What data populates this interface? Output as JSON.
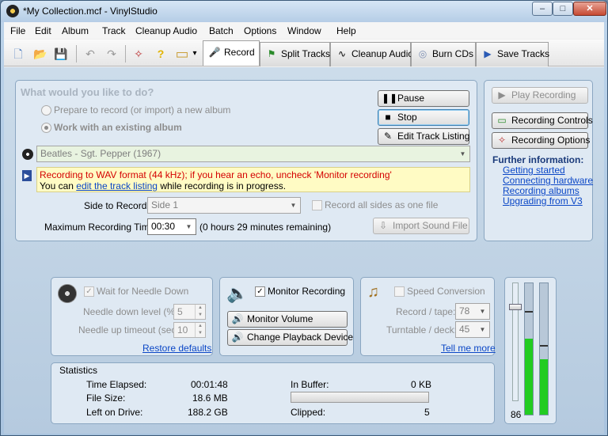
{
  "window": {
    "title": "*My Collection.mcf - VinylStudio",
    "min_glyph": "–",
    "max_glyph": "□",
    "close_glyph": "✕"
  },
  "menu": [
    "File",
    "Edit",
    "Album",
    "Track",
    "Cleanup Audio",
    "Batch",
    "Options",
    "Window",
    "Help"
  ],
  "toolbar": {
    "icons": {
      "new": "new-collection-icon",
      "open": "open-icon",
      "save": "save-icon",
      "undo": "undo-icon",
      "redo": "redo-icon",
      "tools": "wand-icon",
      "help": "help-icon",
      "folder": "folder-dropdown-icon"
    },
    "glyphs": {
      "new": "🗋",
      "open": "📂",
      "save": "💾",
      "undo": "↶",
      "redo": "↷",
      "tools": "✧",
      "help": "?",
      "folder": "▭",
      "dropdown": "▾"
    }
  },
  "tabs": [
    {
      "label": "Record",
      "icon": "🎤",
      "active": true
    },
    {
      "label": "Split Tracks",
      "icon": "⚑",
      "active": false
    },
    {
      "label": "Cleanup Audio",
      "icon": "∿",
      "active": false
    },
    {
      "label": "Burn CDs",
      "icon": "◎",
      "active": false
    },
    {
      "label": "Save Tracks",
      "icon": "▶",
      "active": false
    }
  ],
  "record_panel": {
    "question": "What would you like to do?",
    "option_new": "Prepare to record (or import) a new album",
    "option_existing": "Work with an existing album",
    "selected_option": "existing",
    "album": "Beatles - Sgt. Pepper (1967)",
    "notice_line1": "Recording to WAV format (44 kHz); if you hear an echo, uncheck 'Monitor recording'",
    "notice_line2_before": "You can ",
    "notice_link": "edit the track listing",
    "notice_line2_after": " while recording is in progress.",
    "side_label": "Side to Record:",
    "side_value": "Side 1",
    "record_all_sides": "Record all sides as one file",
    "record_all_sides_checked": false,
    "max_time_label": "Maximum Recording Time:",
    "max_time_value": "00:30",
    "time_remaining": "(0 hours 29 minutes remaining)",
    "import_label": "Import Sound File",
    "pause_label": "Pause",
    "stop_label": "Stop",
    "edit_listing_label": "Edit Track Listing"
  },
  "right_panel": {
    "play_recording": "Play Recording",
    "recording_controls": "Recording Controls",
    "recording_options": "Recording Options",
    "further_info": "Further information:",
    "links": [
      "Getting started",
      "Connecting hardware",
      "Recording albums",
      "Upgrading from V3"
    ]
  },
  "needle": {
    "wait_label": "Wait for Needle Down",
    "wait_checked": true,
    "down_label": "Needle down level (%):",
    "down_value": "5",
    "up_label": "Needle up timeout (sec):",
    "up_value": "10",
    "restore": "Restore defaults"
  },
  "monitor": {
    "label": "Monitor Recording",
    "checked": true,
    "volume_btn": "Monitor Volume",
    "device_btn": "Change Playback Device"
  },
  "speed": {
    "label": "Speed Conversion",
    "checked": false,
    "record_label": "Record / tape:",
    "record_value": "78",
    "turntable_label": "Turntable / deck:",
    "turntable_value": "45",
    "tell_more": "Tell me more"
  },
  "statistics": {
    "title": "Statistics",
    "time_elapsed_label": "Time Elapsed:",
    "time_elapsed": "00:01:48",
    "file_size_label": "File Size:",
    "file_size": "18.6 MB",
    "left_label": "Left on Drive:",
    "left": "188.2 GB",
    "buffer_label": "In Buffer:",
    "buffer": "0 KB",
    "buffer_fraction": 0,
    "clipped_label": "Clipped:",
    "clipped": "5"
  },
  "level": {
    "gain_value": "86",
    "gain_fraction": 0.86,
    "left_level": 0.58,
    "right_level": 0.42,
    "left_peak": 0.78,
    "right_peak": 0.52,
    "meter_color": "#22cc22"
  }
}
